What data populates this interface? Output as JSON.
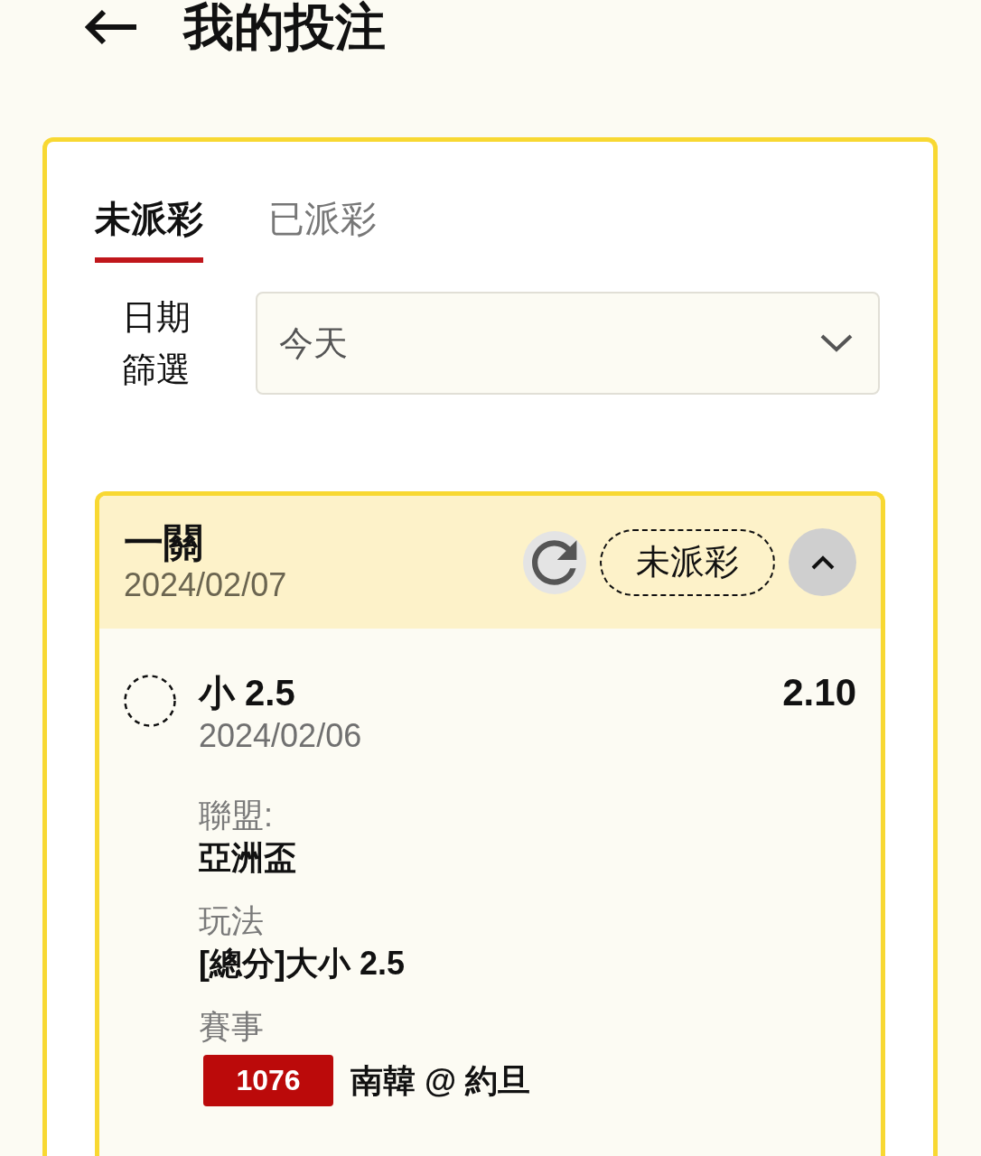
{
  "header": {
    "title": "我的投注"
  },
  "tabs": [
    {
      "label": "未派彩",
      "selected": true
    },
    {
      "label": "已派彩",
      "selected": false
    }
  ],
  "date_filter": {
    "label": "日期篩選",
    "value": "今天"
  },
  "bet": {
    "type": "一關",
    "date": "2024/02/07",
    "status": "未派彩",
    "expanded": true,
    "selections": [
      {
        "pick": "小 2.5",
        "date": "2024/02/06",
        "odds": "2.10",
        "details": [
          {
            "kind": "text",
            "label": "聯盟:",
            "value": "亞洲盃"
          },
          {
            "kind": "text",
            "label": "玩法",
            "value": "[總分]大小 2.5"
          },
          {
            "kind": "match",
            "label": "賽事",
            "match_no": "1076",
            "value": "南韓 @ 約旦"
          }
        ]
      }
    ]
  }
}
